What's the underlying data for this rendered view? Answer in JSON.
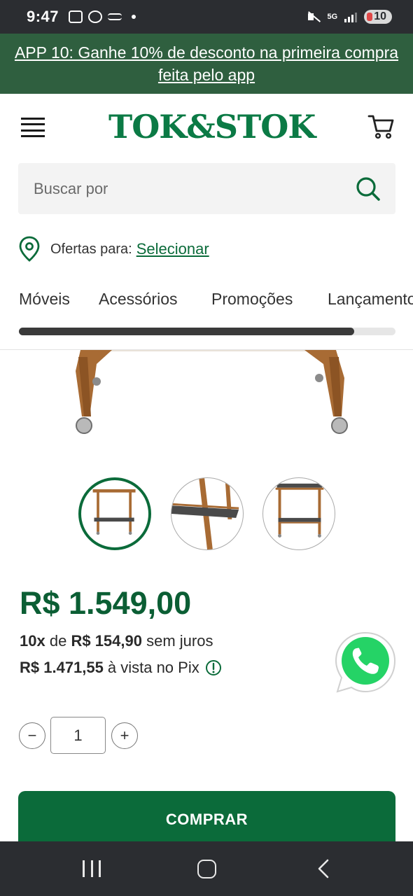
{
  "status_bar": {
    "time": "9:47",
    "network": "5G",
    "battery": "10"
  },
  "promo": {
    "text": "APP 10: Ganhe 10% de desconto na primeira compra feita pelo app"
  },
  "header": {
    "logo": "TOK&STOK"
  },
  "search": {
    "placeholder": "Buscar por"
  },
  "location": {
    "label": "Ofertas para:",
    "link": "Selecionar"
  },
  "categories": {
    "items": [
      "Móveis",
      "Acessórios",
      "Promoções",
      "Lançamentos"
    ],
    "scroll_fraction": 0.89
  },
  "product": {
    "price": "R$ 1.549,00",
    "installments_count": "10x",
    "installments_connector": "de",
    "installments_value": "R$ 154,90",
    "installments_suffix": "sem juros",
    "pix_value": "R$ 1.471,55",
    "pix_suffix": "à vista no Pix",
    "quantity": "1",
    "buy_label": "COMPRAR",
    "thumbnails_count": 3,
    "selected_thumbnail": 0
  },
  "colors": {
    "brand_green": "#0b6b3a",
    "banner_green": "#2f5f3f",
    "price_green": "#0b5e34",
    "whatsapp_green": "#25d366"
  },
  "icons": {
    "menu": "hamburger-icon",
    "cart": "cart-icon",
    "search": "search-icon",
    "location": "location-pin-icon",
    "info": "info-icon",
    "whatsapp": "whatsapp-icon",
    "minus": "minus-icon",
    "plus": "plus-icon"
  }
}
